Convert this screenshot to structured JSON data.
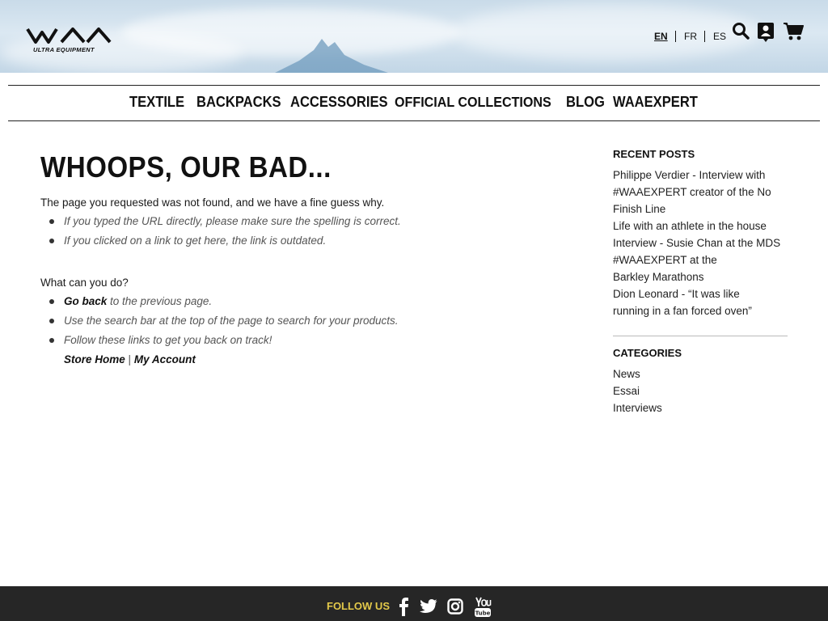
{
  "header": {
    "logo_text": "WAA",
    "logo_subtext": "ULTRA EQUIPMENT",
    "languages": [
      "EN",
      "FR",
      "ES"
    ],
    "active_language": "EN",
    "icons": [
      "search-icon",
      "account-icon",
      "cart-icon"
    ]
  },
  "nav": {
    "items": [
      "TEXTILE",
      "BACKPACKS",
      "ACCESSORIES",
      "OFFICIAL COLLECTIONS",
      "BLOG",
      "WAAEXPERT"
    ]
  },
  "main": {
    "title": "WHOOPS, OUR BAD...",
    "intro": "The page you requested was not found, and we have a fine guess why.",
    "reasons": [
      "If you typed the URL directly, please make sure the spelling is correct.",
      "If you clicked on a link to get here, the link is outdated."
    ],
    "what_heading": "What can you do?",
    "go_back_link": "Go back",
    "go_back_rest": " to the previous page.",
    "search_tip": "Use the search bar at the top of the page to search for your products.",
    "follow_tip": "Follow these links to get you back on track!",
    "store_home_link": "Store Home",
    "link_sep": "|",
    "my_account_link": "My Account"
  },
  "sidebar": {
    "recent_heading": "RECENT POSTS",
    "recent_lines": [
      "Philippe Verdier - Interview with",
      "#WAAEXPERT creator of the No",
      "Finish Line",
      "Life with an athlete in the house",
      "Interview - Susie Chan at the MDS",
      "#WAAEXPERT at the",
      "Barkley Marathons",
      "Dion Leonard - “It was like",
      "running in a fan forced oven”"
    ],
    "categories_heading": "CATEGORIES",
    "categories": [
      "News",
      "Essai",
      "Interviews"
    ]
  },
  "footer": {
    "follow_label": "FOLLOW US",
    "social_icons": [
      "facebook-icon",
      "twitter-icon",
      "instagram-icon",
      "youtube-icon"
    ],
    "accent_color": "#e3c94a",
    "background_color": "#262626"
  }
}
